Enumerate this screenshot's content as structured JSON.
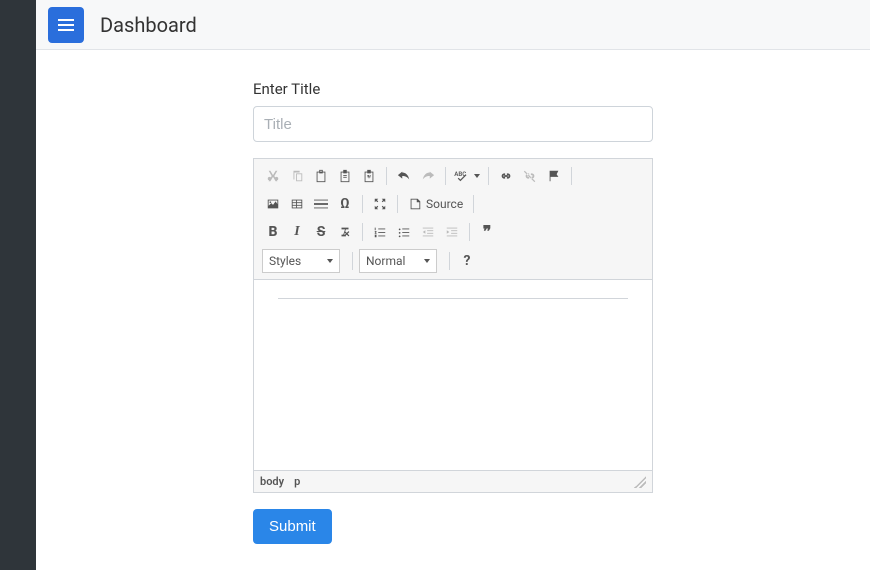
{
  "topbar": {
    "title": "Dashboard"
  },
  "form": {
    "title_label": "Enter Title",
    "title_placeholder": "Title",
    "submit_label": "Submit"
  },
  "editor": {
    "styles_label": "Styles",
    "format_label": "Normal",
    "source_label": "Source",
    "path": [
      "body",
      "p"
    ],
    "about_label": "?"
  },
  "icons": {
    "bold": "B",
    "italic": "I",
    "strike": "S",
    "quote": "❞"
  }
}
